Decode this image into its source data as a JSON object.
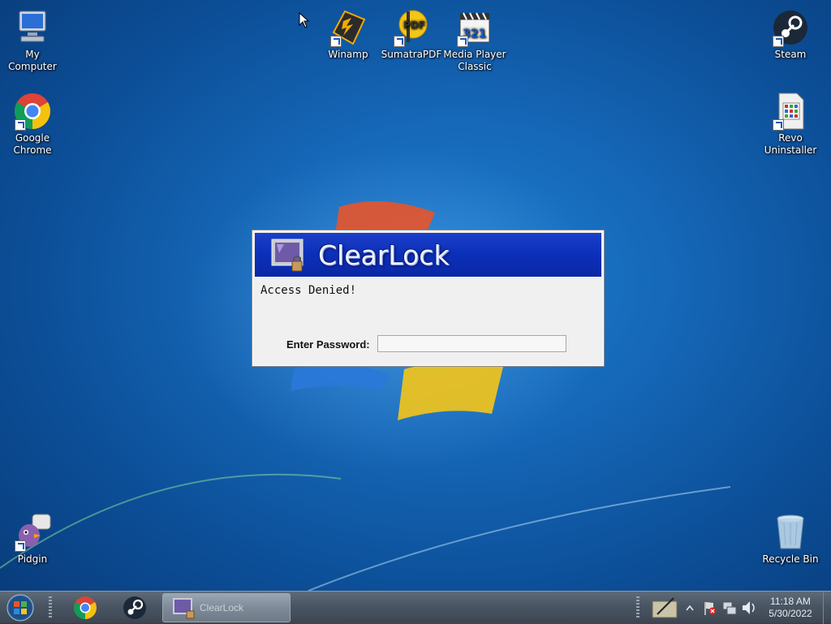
{
  "desktop": {
    "icons": [
      {
        "id": "my-computer",
        "label": "My Computer"
      },
      {
        "id": "google-chrome",
        "label": "Google Chrome"
      },
      {
        "id": "winamp",
        "label": "Winamp"
      },
      {
        "id": "sumatrapdf",
        "label": "SumatraPDF"
      },
      {
        "id": "media-player-classic",
        "label": "Media Player Classic"
      },
      {
        "id": "steam",
        "label": "Steam"
      },
      {
        "id": "revo-uninstaller",
        "label": "Revo Uninstaller"
      },
      {
        "id": "pidgin",
        "label": "Pidgin"
      },
      {
        "id": "recycle-bin",
        "label": "Recycle Bin"
      }
    ]
  },
  "dialog": {
    "title": "ClearLock",
    "message": "Access Denied!",
    "password_label": "Enter Password:",
    "password_value": ""
  },
  "taskbar": {
    "pinned": [
      "google-chrome-icon",
      "steam-icon"
    ],
    "task_label": "ClearLock",
    "clock": {
      "time": "11:18 AM",
      "date": "5/30/2022"
    }
  },
  "colors": {
    "dialog_header": "#0c2fb8",
    "taskbar": "#4a5563",
    "desktop": "#1566b6"
  }
}
